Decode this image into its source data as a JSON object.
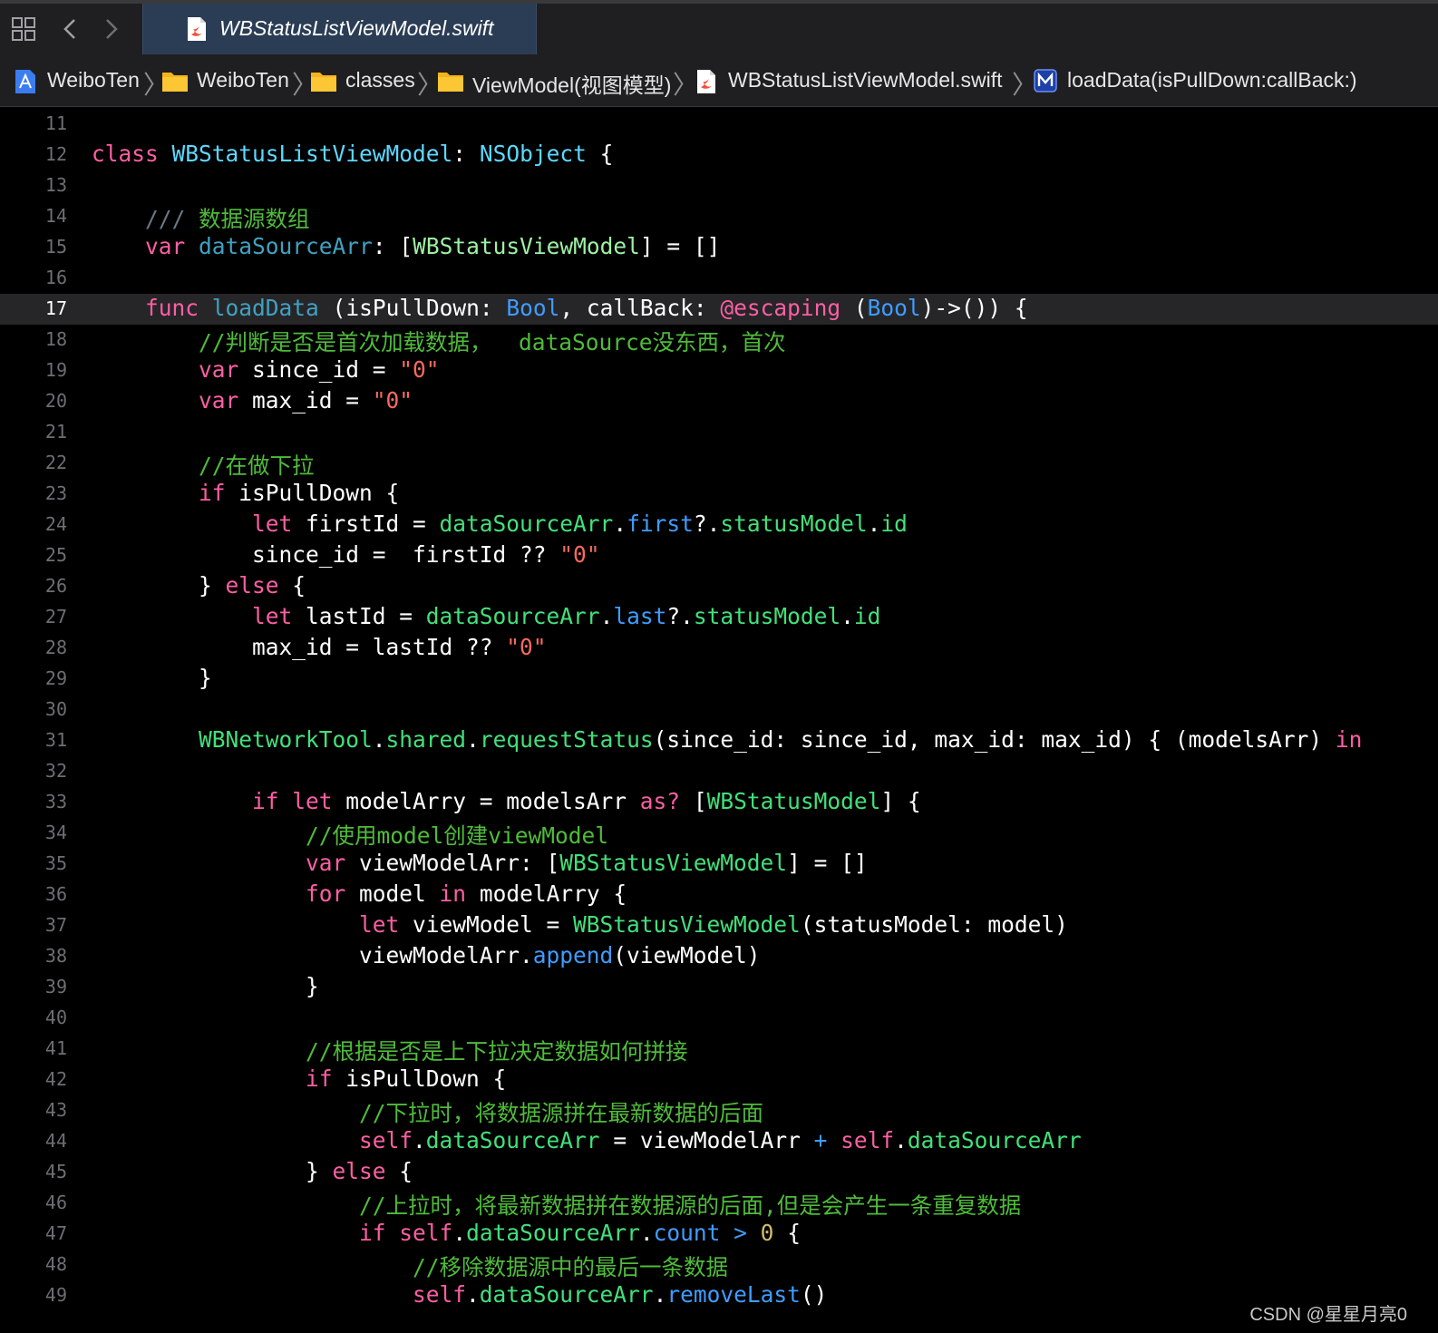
{
  "tab": {
    "title": "WBStatusListViewModel.swift"
  },
  "breadcrumbs": [
    {
      "label": "WeiboTen",
      "icon": "project-icon"
    },
    {
      "label": "WeiboTen",
      "icon": "folder-icon"
    },
    {
      "label": "classes",
      "icon": "folder-icon"
    },
    {
      "label": "ViewModel(视图模型)",
      "icon": "folder-icon"
    },
    {
      "label": "WBStatusListViewModel.swift",
      "icon": "swift-file-icon"
    },
    {
      "label": "loadData(isPullDown:callBack:)",
      "icon": "method-icon"
    }
  ],
  "active_line": 17,
  "lines": [
    {
      "n": "11",
      "tokens": []
    },
    {
      "n": "12",
      "tokens": [
        [
          "kw",
          "class"
        ],
        [
          "p",
          " "
        ],
        [
          "ty",
          "WBStatusListViewModel"
        ],
        [
          "p",
          ": "
        ],
        [
          "ty",
          "NSObject"
        ],
        [
          "p",
          " {"
        ]
      ]
    },
    {
      "n": "13",
      "tokens": []
    },
    {
      "n": "14",
      "tokens": [
        [
          "p",
          "    "
        ],
        [
          "cm",
          "/// "
        ],
        [
          "cmt",
          "数据源数组"
        ]
      ]
    },
    {
      "n": "15",
      "tokens": [
        [
          "p",
          "    "
        ],
        [
          "kw",
          "var"
        ],
        [
          "p",
          " "
        ],
        [
          "cls",
          "dataSourceArr"
        ],
        [
          "p",
          ": ["
        ],
        [
          "pjt",
          "WBStatusViewModel"
        ],
        [
          "p",
          "] = []"
        ]
      ]
    },
    {
      "n": "16",
      "tokens": []
    },
    {
      "n": "17",
      "tokens": [
        [
          "p",
          "    "
        ],
        [
          "kw",
          "func"
        ],
        [
          "p",
          " "
        ],
        [
          "cls",
          "loadData"
        ],
        [
          "p",
          " (isPullDown: "
        ],
        [
          "sys",
          "Bool"
        ],
        [
          "p",
          ", callBack: "
        ],
        [
          "kw",
          "@escaping"
        ],
        [
          "p",
          " ("
        ],
        [
          "sys",
          "Bool"
        ],
        [
          "p",
          ")->()) {"
        ]
      ]
    },
    {
      "n": "18",
      "tokens": [
        [
          "p",
          "        "
        ],
        [
          "cmt",
          "//判断是否是首次加载数据，  dataSource没东西，首次"
        ]
      ]
    },
    {
      "n": "19",
      "tokens": [
        [
          "p",
          "        "
        ],
        [
          "kw",
          "var"
        ],
        [
          "p",
          " since_id = "
        ],
        [
          "str",
          "\"0\""
        ]
      ]
    },
    {
      "n": "20",
      "tokens": [
        [
          "p",
          "        "
        ],
        [
          "kw",
          "var"
        ],
        [
          "p",
          " max_id = "
        ],
        [
          "str",
          "\"0\""
        ]
      ]
    },
    {
      "n": "21",
      "tokens": []
    },
    {
      "n": "22",
      "tokens": [
        [
          "p",
          "        "
        ],
        [
          "cmt",
          "//在做下拉"
        ]
      ]
    },
    {
      "n": "23",
      "tokens": [
        [
          "p",
          "        "
        ],
        [
          "kw",
          "if"
        ],
        [
          "p",
          " isPullDown {"
        ]
      ]
    },
    {
      "n": "24",
      "tokens": [
        [
          "p",
          "            "
        ],
        [
          "kw",
          "let"
        ],
        [
          "p",
          " firstId = "
        ],
        [
          "pjf",
          "dataSourceArr"
        ],
        [
          "p",
          "."
        ],
        [
          "sys",
          "first"
        ],
        [
          "p",
          "?."
        ],
        [
          "pjf",
          "statusModel"
        ],
        [
          "p",
          "."
        ],
        [
          "pjf",
          "id"
        ]
      ]
    },
    {
      "n": "25",
      "tokens": [
        [
          "p",
          "            since_id =  firstId ?? "
        ],
        [
          "str",
          "\"0\""
        ]
      ]
    },
    {
      "n": "26",
      "tokens": [
        [
          "p",
          "        } "
        ],
        [
          "kw",
          "else"
        ],
        [
          "p",
          " {"
        ]
      ]
    },
    {
      "n": "27",
      "tokens": [
        [
          "p",
          "            "
        ],
        [
          "kw",
          "let"
        ],
        [
          "p",
          " lastId = "
        ],
        [
          "pjf",
          "dataSourceArr"
        ],
        [
          "p",
          "."
        ],
        [
          "sys",
          "last"
        ],
        [
          "p",
          "?."
        ],
        [
          "pjf",
          "statusModel"
        ],
        [
          "p",
          "."
        ],
        [
          "pjf",
          "id"
        ]
      ]
    },
    {
      "n": "28",
      "tokens": [
        [
          "p",
          "            max_id = lastId ?? "
        ],
        [
          "str",
          "\"0\""
        ]
      ]
    },
    {
      "n": "29",
      "tokens": [
        [
          "p",
          "        }"
        ]
      ]
    },
    {
      "n": "30",
      "tokens": []
    },
    {
      "n": "31",
      "tokens": [
        [
          "p",
          "        "
        ],
        [
          "pjf",
          "WBNetworkTool"
        ],
        [
          "p",
          "."
        ],
        [
          "pjf",
          "shared"
        ],
        [
          "p",
          "."
        ],
        [
          "pjf",
          "requestStatus"
        ],
        [
          "p",
          "(since_id: since_id, max_id: max_id) { (modelsArr) "
        ],
        [
          "kw",
          "in"
        ]
      ]
    },
    {
      "n": "32",
      "tokens": []
    },
    {
      "n": "33",
      "tokens": [
        [
          "p",
          "            "
        ],
        [
          "kw",
          "if let"
        ],
        [
          "p",
          " modelArry = modelsArr "
        ],
        [
          "kw",
          "as?"
        ],
        [
          "p",
          " ["
        ],
        [
          "pjf",
          "WBStatusModel"
        ],
        [
          "p",
          "] {"
        ]
      ]
    },
    {
      "n": "34",
      "tokens": [
        [
          "p",
          "                "
        ],
        [
          "cmt",
          "//使用model创建viewModel"
        ]
      ]
    },
    {
      "n": "35",
      "tokens": [
        [
          "p",
          "                "
        ],
        [
          "kw",
          "var"
        ],
        [
          "p",
          " viewModelArr: ["
        ],
        [
          "pjf",
          "WBStatusViewModel"
        ],
        [
          "p",
          "] = []"
        ]
      ]
    },
    {
      "n": "36",
      "tokens": [
        [
          "p",
          "                "
        ],
        [
          "kw",
          "for"
        ],
        [
          "p",
          " model "
        ],
        [
          "kw",
          "in"
        ],
        [
          "p",
          " modelArry {"
        ]
      ]
    },
    {
      "n": "37",
      "tokens": [
        [
          "p",
          "                    "
        ],
        [
          "kw",
          "let"
        ],
        [
          "p",
          " viewModel = "
        ],
        [
          "pjf",
          "WBStatusViewModel"
        ],
        [
          "p",
          "(statusModel: model)"
        ]
      ]
    },
    {
      "n": "38",
      "tokens": [
        [
          "p",
          "                    viewModelArr."
        ],
        [
          "sys",
          "append"
        ],
        [
          "p",
          "(viewModel)"
        ]
      ]
    },
    {
      "n": "39",
      "tokens": [
        [
          "p",
          "                }"
        ]
      ]
    },
    {
      "n": "40",
      "tokens": []
    },
    {
      "n": "41",
      "tokens": [
        [
          "p",
          "                "
        ],
        [
          "cmt",
          "//根据是否是上下拉决定数据如何拼接"
        ]
      ]
    },
    {
      "n": "42",
      "tokens": [
        [
          "p",
          "                "
        ],
        [
          "kw",
          "if"
        ],
        [
          "p",
          " isPullDown {"
        ]
      ]
    },
    {
      "n": "43",
      "tokens": [
        [
          "p",
          "                    "
        ],
        [
          "cmt",
          "//下拉时，将数据源拼在最新数据的后面"
        ]
      ]
    },
    {
      "n": "44",
      "tokens": [
        [
          "p",
          "                    "
        ],
        [
          "kw",
          "self"
        ],
        [
          "p",
          "."
        ],
        [
          "pjf",
          "dataSourceArr"
        ],
        [
          "p",
          " = viewModelArr "
        ],
        [
          "sys",
          "+"
        ],
        [
          "p",
          " "
        ],
        [
          "kw",
          "self"
        ],
        [
          "p",
          "."
        ],
        [
          "pjf",
          "dataSourceArr"
        ]
      ]
    },
    {
      "n": "45",
      "tokens": [
        [
          "p",
          "                } "
        ],
        [
          "kw",
          "else"
        ],
        [
          "p",
          " {"
        ]
      ]
    },
    {
      "n": "46",
      "tokens": [
        [
          "p",
          "                    "
        ],
        [
          "cmt",
          "//上拉时，将最新数据拼在数据源的后面,但是会产生一条重复数据"
        ]
      ]
    },
    {
      "n": "47",
      "tokens": [
        [
          "p",
          "                    "
        ],
        [
          "kw",
          "if"
        ],
        [
          "p",
          " "
        ],
        [
          "kw",
          "self"
        ],
        [
          "p",
          "."
        ],
        [
          "pjf",
          "dataSourceArr"
        ],
        [
          "p",
          "."
        ],
        [
          "sys",
          "count"
        ],
        [
          "p",
          " "
        ],
        [
          "sys",
          ">"
        ],
        [
          "p",
          " "
        ],
        [
          "num",
          "0"
        ],
        [
          "p",
          " {"
        ]
      ]
    },
    {
      "n": "48",
      "tokens": [
        [
          "p",
          "                        "
        ],
        [
          "cmt",
          "//移除数据源中的最后一条数据"
        ]
      ]
    },
    {
      "n": "49",
      "tokens": [
        [
          "p",
          "                        "
        ],
        [
          "kw",
          "self"
        ],
        [
          "p",
          "."
        ],
        [
          "pjf",
          "dataSourceArr"
        ],
        [
          "p",
          "."
        ],
        [
          "sys",
          "removeLast"
        ],
        [
          "p",
          "()"
        ]
      ]
    }
  ],
  "watermark": "CSDN @星星月亮0",
  "colors": {
    "background": "#000000",
    "keyword": "#fc5fa3",
    "comment": "#4fbb3a",
    "string": "#fc6a5d",
    "type": "#5dd8ff",
    "project_symbol": "#42e07a",
    "system_symbol": "#3f9cff"
  }
}
